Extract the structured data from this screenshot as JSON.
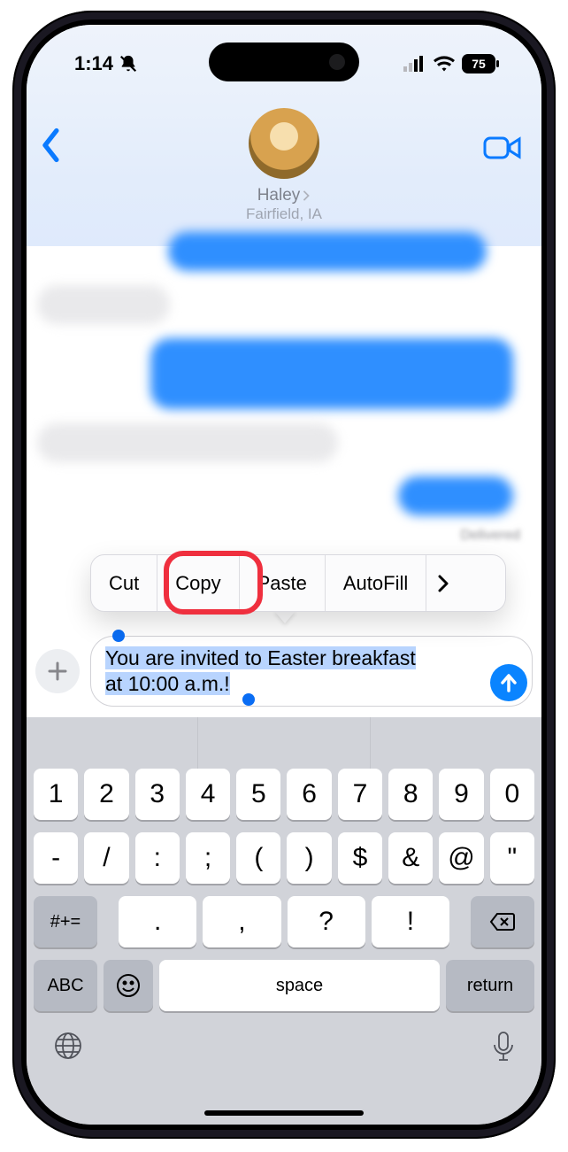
{
  "status": {
    "time": "1:14",
    "battery": "75"
  },
  "header": {
    "contact_name": "Haley",
    "location": "Fairfield, IA"
  },
  "messages": {
    "delivered_label": "Delivered"
  },
  "context_menu": {
    "cut": "Cut",
    "copy": "Copy",
    "paste": "Paste",
    "autofill": "AutoFill"
  },
  "compose": {
    "text_line1": "You are invited to Easter breakfast",
    "text_line2": "at 10:00 a.m.!"
  },
  "keyboard": {
    "row1": [
      "1",
      "2",
      "3",
      "4",
      "5",
      "6",
      "7",
      "8",
      "9",
      "0"
    ],
    "row2": [
      "-",
      "/",
      ":",
      ";",
      "(",
      ")",
      "$",
      "&",
      "@",
      "\""
    ],
    "switch_sym": "#+=",
    "row3": [
      ".",
      ",",
      "?",
      "!"
    ],
    "abc": "ABC",
    "space": "space",
    "return": "return"
  }
}
